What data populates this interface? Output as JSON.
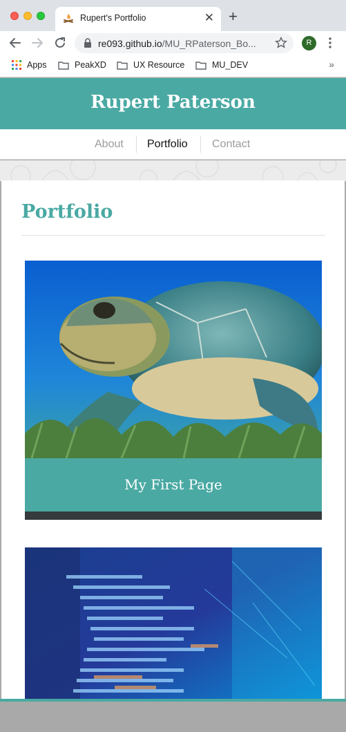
{
  "browser": {
    "tab_title": "Rupert's Portfolio",
    "close_glyph": "✕",
    "new_tab_glyph": "+",
    "url_host": "re093.github.io",
    "url_path": "/MU_RPaterson_Bo...",
    "profile_initial": "R",
    "bookmarks": [
      {
        "label": "Apps",
        "icon": "apps-grid-icon"
      },
      {
        "label": "PeakXD",
        "icon": "folder-icon"
      },
      {
        "label": "UX Resource",
        "icon": "folder-icon"
      },
      {
        "label": "MU_DEV",
        "icon": "folder-icon"
      }
    ],
    "bookmarks_more": "»"
  },
  "site": {
    "title": "Rupert Paterson",
    "nav": [
      "About",
      "Portfolio",
      "Contact"
    ],
    "active_nav": "Portfolio",
    "accent_color": "#4aa9a3"
  },
  "main": {
    "heading": "Portfolio",
    "cards": [
      {
        "caption": "My First Page",
        "image": "sea-turtle-underwater"
      },
      {
        "caption": "",
        "image": "code-screen-blurred"
      }
    ]
  }
}
